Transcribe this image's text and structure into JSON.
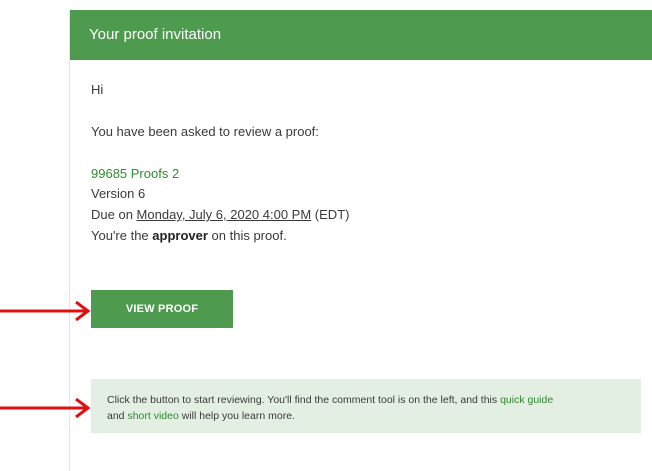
{
  "header": {
    "title": "Your proof invitation"
  },
  "message": {
    "greeting": "Hi",
    "intro": "You have been asked to review a proof:",
    "proof_name": "99685 Proofs 2",
    "version": "Version 6",
    "due_prefix": "Due on ",
    "due_date": "Monday, July 6, 2020 4:00 PM",
    "due_tz": " (EDT)",
    "role_prefix": "You're the ",
    "role": "approver",
    "role_suffix": " on this proof."
  },
  "actions": {
    "view_proof_label": "VIEW PROOF"
  },
  "note": {
    "text_1": "Click the button to start reviewing. You'll find the comment tool is on the left, and this ",
    "link_1": "quick guide",
    "text_2": "and ",
    "link_2": "short video",
    "text_3": " will help you learn more."
  },
  "colors": {
    "header_bg": "#4e9a4e",
    "accent_link": "#2e8b2e",
    "note_bg": "#e3efe3",
    "arrow": "#e01010"
  },
  "annotations": {
    "arrow_icon": "red-right-arrow-icon"
  }
}
